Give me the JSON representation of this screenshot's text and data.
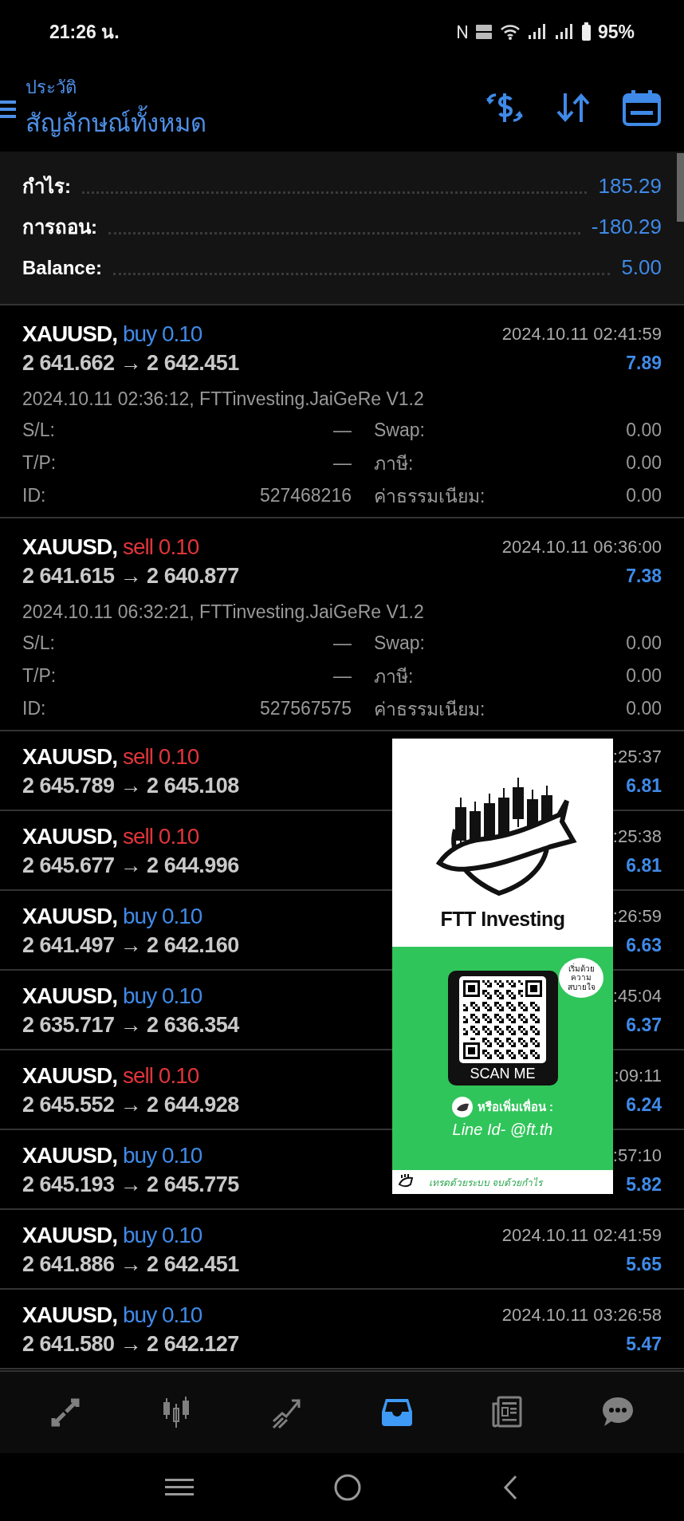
{
  "status_bar": {
    "time": "21:26 น.",
    "battery": "95%"
  },
  "header": {
    "subtitle": "ประวัติ",
    "title": "สัญลักษณ์ทั้งหมด"
  },
  "summary": [
    {
      "label": "กำไร:",
      "value": "185.29"
    },
    {
      "label": "การถอน:",
      "value": "-180.29"
    },
    {
      "label": "Balance:",
      "value": "5.00"
    }
  ],
  "trades": [
    {
      "symbol": "XAUUSD,",
      "kind": "buy",
      "side": "buy 0.10",
      "prices": "2 641.662 → 2 642.451",
      "time": "2024.10.11 02:41:59",
      "profit": "7.89",
      "expanded": true,
      "info": "2024.10.11 02:36:12, FTTinvesting.JaiGeRe V1.2",
      "details": [
        {
          "label": "S/L:",
          "value": "—",
          "label2": "Swap:",
          "value2": "0.00"
        },
        {
          "label": "T/P:",
          "value": "—",
          "label2": "ภาษี:",
          "value2": "0.00"
        },
        {
          "label": "ID:",
          "value": "527468216",
          "label2": "ค่าธรรมเนียม:",
          "value2": "0.00"
        }
      ]
    },
    {
      "symbol": "XAUUSD,",
      "kind": "sell",
      "side": "sell 0.10",
      "prices": "2 641.615 → 2 640.877",
      "time": "2024.10.11 06:36:00",
      "profit": "7.38",
      "expanded": true,
      "info": "2024.10.11 06:32:21, FTTinvesting.JaiGeRe V1.2",
      "details": [
        {
          "label": "S/L:",
          "value": "—",
          "label2": "Swap:",
          "value2": "0.00"
        },
        {
          "label": "T/P:",
          "value": "—",
          "label2": "ภาษี:",
          "value2": "0.00"
        },
        {
          "label": "ID:",
          "value": "527567575",
          "label2": "ค่าธรรมเนียม:",
          "value2": "0.00"
        }
      ]
    },
    {
      "symbol": "XAUUSD,",
      "kind": "sell",
      "side": "sell 0.10",
      "prices": "2 645.789 → 2 645.108",
      "time": ":25:37",
      "profit": "6.81",
      "expanded": false
    },
    {
      "symbol": "XAUUSD,",
      "kind": "sell",
      "side": "sell 0.10",
      "prices": "2 645.677 → 2 644.996",
      "time": ":25:38",
      "profit": "6.81",
      "expanded": false
    },
    {
      "symbol": "XAUUSD,",
      "kind": "buy",
      "side": "buy 0.10",
      "prices": "2 641.497 → 2 642.160",
      "time": ":26:59",
      "profit": "6.63",
      "expanded": false
    },
    {
      "symbol": "XAUUSD,",
      "kind": "buy",
      "side": "buy 0.10",
      "prices": "2 635.717 → 2 636.354",
      "time": ":45:04",
      "profit": "6.37",
      "expanded": false
    },
    {
      "symbol": "XAUUSD,",
      "kind": "sell",
      "side": "sell 0.10",
      "prices": "2 645.552 → 2 644.928",
      "time": ":09:11",
      "profit": "6.24",
      "expanded": false
    },
    {
      "symbol": "XAUUSD,",
      "kind": "buy",
      "side": "buy 0.10",
      "prices": "2 645.193 → 2 645.775",
      "time": ":57:10",
      "profit": "5.82",
      "expanded": false
    },
    {
      "symbol": "XAUUSD,",
      "kind": "buy",
      "side": "buy 0.10",
      "prices": "2 641.886 → 2 642.451",
      "time": "2024.10.11 02:41:59",
      "profit": "5.65",
      "expanded": false
    },
    {
      "symbol": "XAUUSD,",
      "kind": "buy",
      "side": "buy 0.10",
      "prices": "2 641.580 → 2 642.127",
      "time": "2024.10.11 03:26:58",
      "profit": "5.47",
      "expanded": false
    }
  ],
  "bottom_nav": [
    {
      "selected": false
    },
    {
      "selected": false
    },
    {
      "selected": false
    },
    {
      "selected": true
    },
    {
      "selected": false
    },
    {
      "selected": false
    }
  ],
  "promo": {
    "brand": "FTT Investing",
    "bubble": "เริ่มด้วยความ สบายใจ",
    "scan": "SCAN ME",
    "add_friend": "หรือเพิ่มเพื่อน :",
    "line_id": "Line Id- @ft.th",
    "slogan": "เทรดด้วยระบบ จบด้วยกำไร"
  }
}
